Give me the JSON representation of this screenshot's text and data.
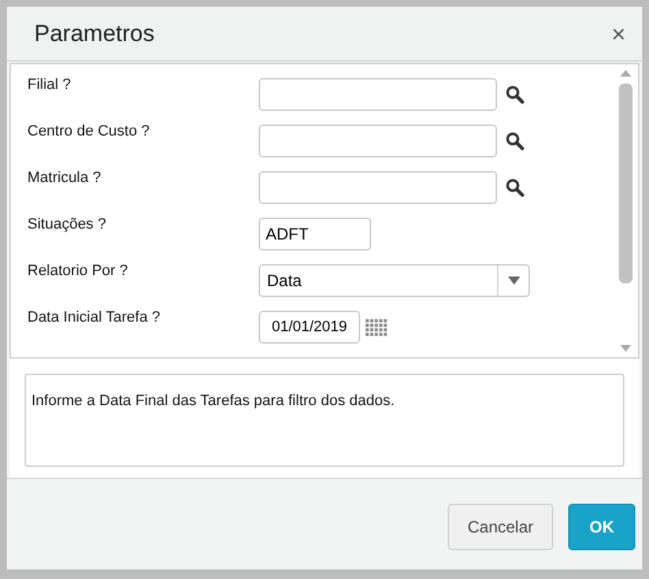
{
  "window": {
    "title": "Parametros",
    "close": "×"
  },
  "fields": [
    {
      "label": "Filial ?",
      "kind": "lookup"
    },
    {
      "label": "Centro de Custo ?",
      "kind": "lookup"
    },
    {
      "label": "Matricula ?",
      "kind": "lookup"
    },
    {
      "label": "Situações ?",
      "kind": "text",
      "value": "ADFT"
    },
    {
      "label": "Relatorio Por ?",
      "kind": "select",
      "value": "Data"
    },
    {
      "label": "Data Inicial Tarefa ?",
      "kind": "date",
      "value": "01/01/2019"
    }
  ],
  "help": "Informe a Data Final das Tarefas para filtro dos dados.",
  "buttons": [
    {
      "label": "Cancelar",
      "kind": "secondary"
    },
    {
      "label": "OK",
      "kind": "primary"
    }
  ]
}
